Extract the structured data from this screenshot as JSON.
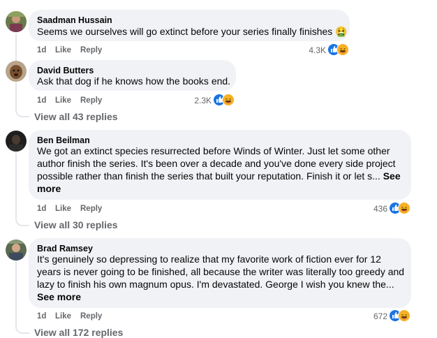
{
  "colors": {
    "bubble": "#f0f2f5",
    "meta": "#65676b",
    "like_blue": "#1b74e4",
    "haha_yellow": "#f7b125"
  },
  "comments": [
    {
      "author": "Saadman Hussain",
      "text": "Seems we ourselves will go extinct before your series finally finishes",
      "emoji": "🤮",
      "age": "1d",
      "like": "Like",
      "reply": "Reply",
      "reaction_count": "4.3K",
      "reactions": [
        "like-icon",
        "haha-icon"
      ]
    },
    {
      "author": "David Butters",
      "text": "Ask that dog if he knows how the books end.",
      "age": "1d",
      "like": "Like",
      "reply": "Reply",
      "reaction_count": "2.3K",
      "reactions": [
        "like-icon",
        "haha-icon"
      ],
      "view_replies": "View all 43 replies"
    },
    {
      "author": "Ben Beilman",
      "lines": [
        "We got an extinct species resurrected before Winds of Winter. Just let some other",
        "author finish the series. It's been over a decade and you've done every side project",
        "possible rather than finish the series that built your reputation. Finish it or let s..."
      ],
      "see_more_a": "See",
      "see_more_b": "more",
      "age": "1d",
      "like": "Like",
      "reply": "Reply",
      "reaction_count": "436",
      "reactions": [
        "like-icon",
        "haha-icon"
      ],
      "view_replies": "View all 30 replies"
    },
    {
      "author": "Brad Ramsey",
      "lines": [
        "It's genuinely so depressing to realize that my favorite work of fiction ever for 12",
        "years is never going to be finished, all because the writer was literally too greedy and",
        "lazy to finish his own magnum opus. I'm devastated. George I wish you knew the..."
      ],
      "see_more": "See more",
      "age": "1d",
      "like": "Like",
      "reply": "Reply",
      "reaction_count": "672",
      "reactions": [
        "like-icon",
        "haha-icon"
      ],
      "view_replies": "View all 172 replies"
    }
  ]
}
